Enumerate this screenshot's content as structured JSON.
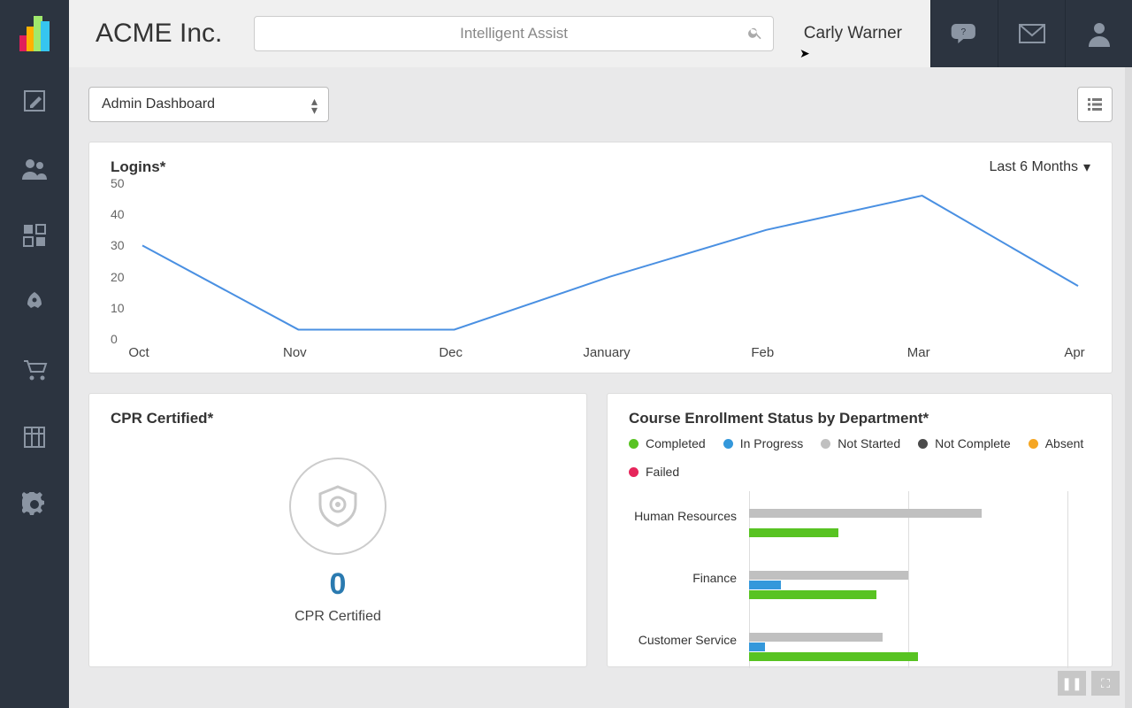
{
  "header": {
    "company": "ACME Inc.",
    "search_placeholder": "Intelligent Assist",
    "user_name": "Carly Warner"
  },
  "dashboard": {
    "selector_label": "Admin Dashboard"
  },
  "logins_card": {
    "title": "Logins*",
    "range_label": "Last 6 Months"
  },
  "cpr_card": {
    "title": "CPR Certified*",
    "value": "0",
    "label": "CPR Certified"
  },
  "dept_card": {
    "title": "Course Enrollment Status by Department*",
    "legend": {
      "completed": "Completed",
      "in_progress": "In Progress",
      "not_started": "Not Started",
      "not_complete": "Not Complete",
      "absent": "Absent",
      "failed": "Failed"
    }
  },
  "colors": {
    "completed": "#58c322",
    "in_progress": "#3498db",
    "not_started": "#c0c0c0",
    "not_complete": "#4a4a4a",
    "absent": "#f5a623",
    "failed": "#e6255b"
  },
  "chart_data": [
    {
      "id": "logins",
      "type": "line",
      "title": "Logins*",
      "categories": [
        "Oct",
        "Nov",
        "Dec",
        "January",
        "Feb",
        "Mar",
        "Apr"
      ],
      "values": [
        30,
        3,
        3,
        20,
        35,
        46,
        17
      ],
      "ylim": [
        0,
        50
      ],
      "yticks": [
        0,
        10,
        20,
        30,
        40,
        50
      ],
      "xlabel": "",
      "ylabel": ""
    },
    {
      "id": "dept_enrollment",
      "type": "bar",
      "orientation": "horizontal",
      "title": "Course Enrollment Status by Department*",
      "categories": [
        "Human Resources",
        "Finance",
        "Customer Service"
      ],
      "series": [
        {
          "name": "Not Started",
          "values": [
            73,
            50,
            42
          ]
        },
        {
          "name": "In Progress",
          "values": [
            0,
            10,
            5
          ]
        },
        {
          "name": "Completed",
          "values": [
            28,
            40,
            53
          ]
        }
      ],
      "xlim": [
        0,
        100
      ]
    }
  ]
}
